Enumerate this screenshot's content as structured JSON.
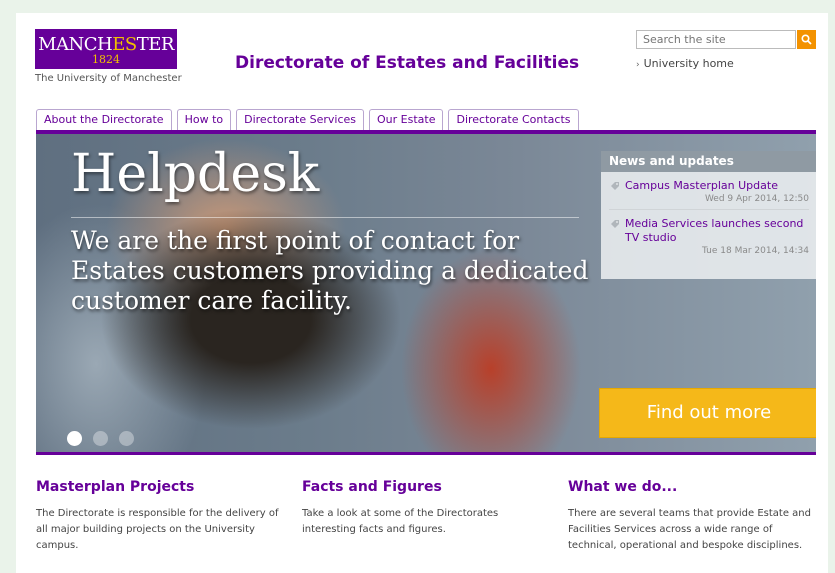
{
  "header": {
    "logo": {
      "name_part1": "MANCH",
      "name_part2": "ES",
      "name_part3": "TER",
      "year": "1824",
      "subtitle": "The University of Manchester"
    },
    "site_title": "Directorate of Estates and Facilities",
    "search_placeholder": "Search the site",
    "university_home": "University home"
  },
  "nav": {
    "tabs": [
      "About the Directorate",
      "How to",
      "Directorate Services",
      "Our Estate",
      "Directorate Contacts"
    ]
  },
  "hero": {
    "title": "Helpdesk",
    "text": "We are the first point of contact for Estates customers providing a dedicated customer care facility.",
    "cta": "Find out more",
    "slides": [
      {
        "active": true
      },
      {
        "active": false
      },
      {
        "active": false
      }
    ]
  },
  "news": {
    "heading": "News and updates",
    "items": [
      {
        "title": "Campus Masterplan Update",
        "date": "Wed 9 Apr 2014, 12:50"
      },
      {
        "title": "Media Services launches second TV studio",
        "date": "Tue 18 Mar 2014, 14:34"
      }
    ]
  },
  "columns": [
    {
      "title": "Masterplan Projects",
      "text": "The Directorate is responsible for the delivery of all major building projects on the University campus."
    },
    {
      "title": "Facts and Figures",
      "text": "Take a look at some of the Directorates interesting facts and figures."
    },
    {
      "title": "What we do...",
      "text": "There are several teams that provide Estate and Facilities Services across a wide range of technical, operational and bespoke disciplines."
    }
  ],
  "colors": {
    "brand_purple": "#660099",
    "accent_orange": "#f39200",
    "cta_gold": "#f5b819"
  }
}
